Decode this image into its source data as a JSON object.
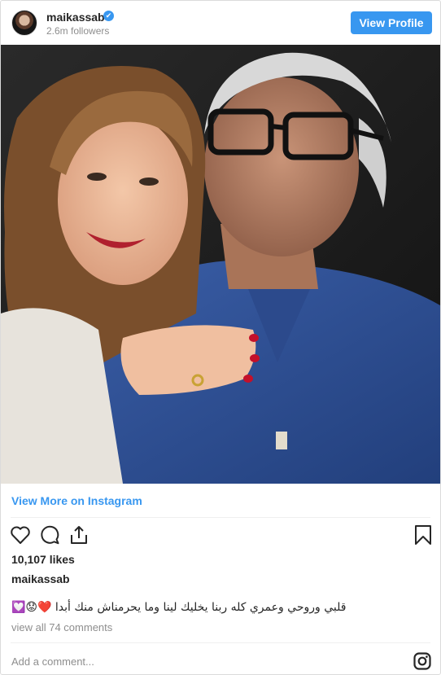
{
  "header": {
    "username": "maikassab",
    "followers": "2.6m followers",
    "verified_mark": "✔",
    "view_profile_label": "View Profile"
  },
  "photo": {
    "icon": "photo"
  },
  "links": {
    "view_more": "View More on Instagram"
  },
  "actions": {
    "like_icon": "heart-icon",
    "comment_icon": "comment-icon",
    "share_icon": "share-icon",
    "save_icon": "bookmark-icon"
  },
  "post": {
    "likes": "10,107 likes",
    "caption_user": "maikassab",
    "caption_text": "قلبي وروحي وعمري كله ربنا يخليك لينا وما يحرمناش منك أبدا ❤️😟💟",
    "view_comments": "view all 74 comments"
  },
  "footer": {
    "add_comment_placeholder": "Add a comment...",
    "logo_icon": "instagram-icon"
  },
  "colors": {
    "accent": "#3897f0",
    "text": "#262626",
    "muted": "#8e8e8e",
    "border": "#dbdbdb"
  }
}
